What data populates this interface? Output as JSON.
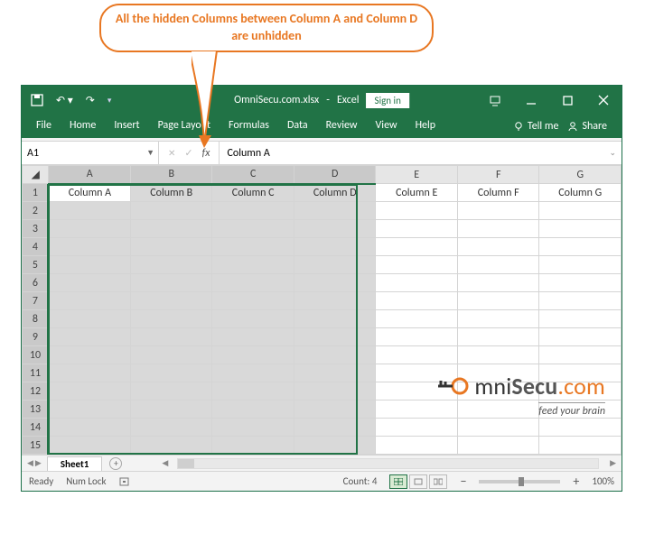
{
  "callout_text": "All the hidden Columns between  Column A and Column D are unhidden",
  "titlebar": {
    "filename": "OmniSecu.com.xlsx",
    "appname": "Excel",
    "signin": "Sign in"
  },
  "ribbon": {
    "tabs": [
      "File",
      "Home",
      "Insert",
      "Page Layout",
      "Formulas",
      "Data",
      "Review",
      "View",
      "Help"
    ],
    "tellme": "Tell me",
    "share": "Share"
  },
  "fx": {
    "name_box": "A1",
    "formula": "Column A"
  },
  "columns": [
    "A",
    "B",
    "C",
    "D",
    "E",
    "F",
    "G"
  ],
  "rows": [
    "1",
    "2",
    "3",
    "4",
    "5",
    "6",
    "7",
    "8",
    "9",
    "10",
    "11",
    "12",
    "13",
    "14",
    "15"
  ],
  "row1": {
    "A": "Column A",
    "B": "Column B",
    "C": "Column  C",
    "D": "Column D",
    "E": "Column E",
    "F": "Column F",
    "G": "Column G"
  },
  "sheet": {
    "name": "Sheet1"
  },
  "status": {
    "ready": "Ready",
    "numlock": "Num Lock",
    "count": "Count: 4",
    "zoom": "100%"
  },
  "logo": {
    "text1": "mni",
    "text2": "Secu",
    "text3": ".com",
    "sub": "feed your brain"
  }
}
